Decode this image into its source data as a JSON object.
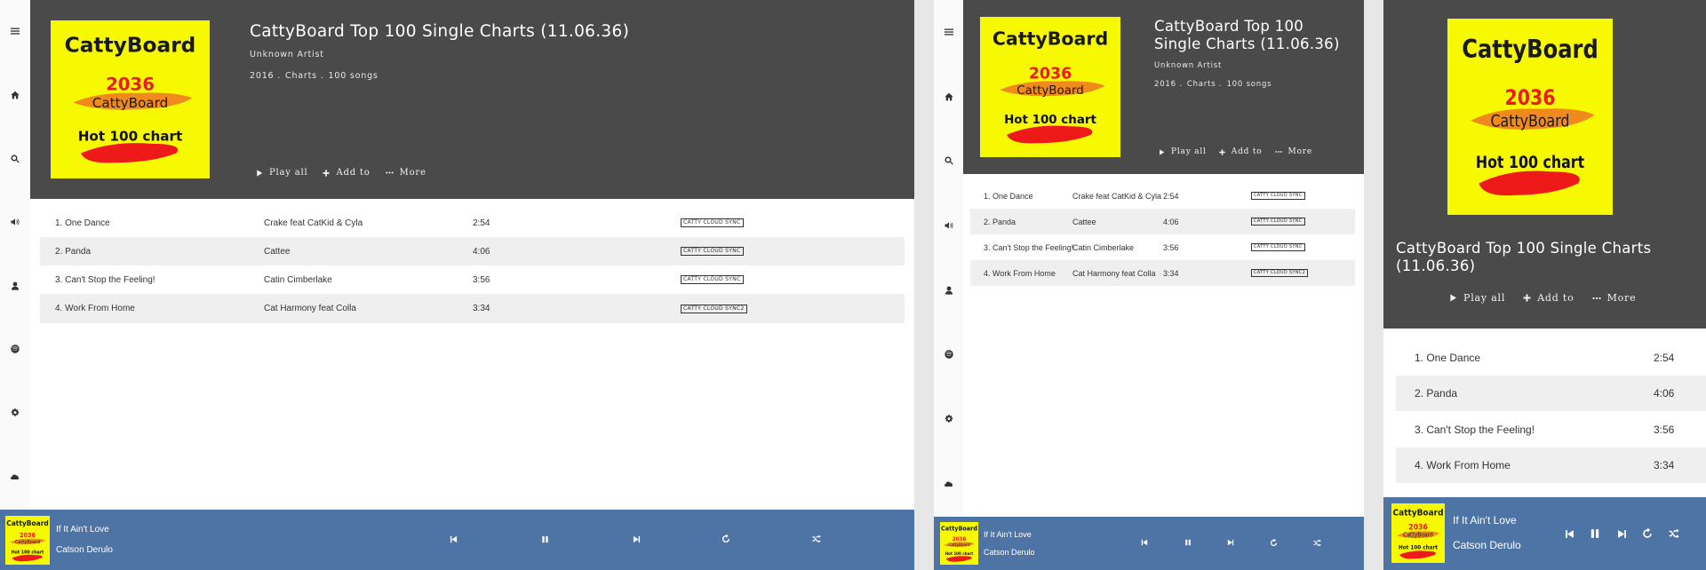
{
  "playlist": {
    "title": "CattyBoard Top 100 Single Charts (11.06.36)",
    "title_wrap_line1": "CattyBoard Top 100",
    "title_wrap_line2": "Single Charts (11.06.36)",
    "mobile_title_line1": "CattyBoard Top 100 Single Charts",
    "mobile_title_line2": "(11.06.36)",
    "artist": "Unknown Artist",
    "year": "2016 .",
    "genre": "Charts .",
    "count": "100 songs"
  },
  "cover_art": {
    "brand": "CattyBoard",
    "year": "2036",
    "sub": "CattyBoard",
    "chart": "Hot 100 chart"
  },
  "actions": {
    "play_all": "Play all",
    "add_to": "Add to",
    "more": "More"
  },
  "tracks": [
    {
      "title": "1. One Dance",
      "artist": "Crake feat CatKid & Cyla",
      "duration": "2:54",
      "badge": "CATTY CLOUD SYNC"
    },
    {
      "title": "2. Panda",
      "artist": "Cattee",
      "duration": "4:06",
      "badge": "CATTY CLOUD SYNC"
    },
    {
      "title": "3. Can't Stop the Feeling!",
      "artist": "Catin Cimberlake",
      "duration": "3:56",
      "badge": "CATTY CLOUD SYNC"
    },
    {
      "title": "4. Work From Home",
      "artist": "Cat Harmony feat Colla",
      "duration": "3:34",
      "badge": "CATTY CLOUD SYNC2"
    }
  ],
  "now_playing": {
    "song": "If It Ain't Love",
    "artist": "Catson Derulo"
  },
  "sidebar_icons": [
    "menu-icon",
    "home-icon",
    "search-icon",
    "volume-icon",
    "user-icon",
    "spotify-icon",
    "gear-icon",
    "soundcloud-icon"
  ],
  "player_icons": [
    "previous-icon",
    "pause-icon",
    "next-icon",
    "repeat-icon",
    "shuffle-icon"
  ],
  "colors": {
    "header_bg": "#4a4a4a",
    "player_bg": "#4e73a5",
    "cover_yellow": "#f7f900",
    "alt_row": "#efefef"
  }
}
